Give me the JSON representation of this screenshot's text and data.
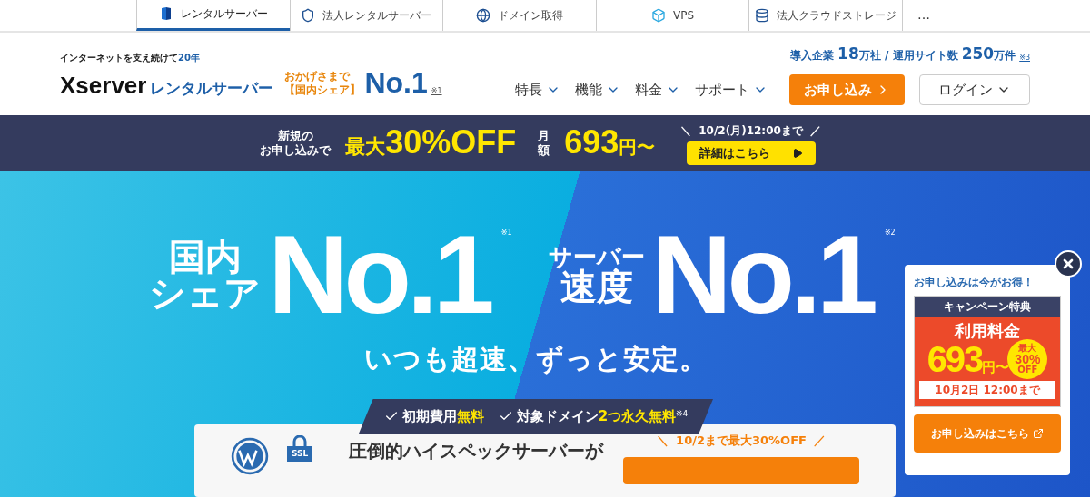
{
  "top_nav": {
    "items": [
      {
        "label": "レンタルサーバー",
        "selected": true,
        "kind": "server"
      },
      {
        "label": "法人レンタルサーバー",
        "selected": false,
        "kind": "shield"
      },
      {
        "label": "ドメイン取得",
        "selected": false,
        "kind": "globe"
      },
      {
        "label": "VPS",
        "selected": false,
        "kind": "cube"
      },
      {
        "label": "法人クラウドストレージ",
        "selected": false,
        "kind": "database"
      }
    ],
    "more": "…"
  },
  "header": {
    "tagline": "インターネットを支え続けて**20年**",
    "logo_word": "Xserver",
    "logo_sub": "レンタルサーバー",
    "award_lines": [
      "おかげさまで",
      "【国内シェア】"
    ],
    "award_big": "No.1",
    "award_note": "※1",
    "stats": "導入企業 **18**万社 / 運用サイト数 **250**万件",
    "stats_note": "※3",
    "menu": [
      "特長",
      "機能",
      "料金",
      "サポート"
    ],
    "cta": "お申し込み",
    "login": "ログイン"
  },
  "banner": {
    "lead": [
      "新規の",
      "お申し込みで"
    ],
    "max": "最大",
    "discount": "30%OFF",
    "monthly": [
      "月",
      "額"
    ],
    "price": "693",
    "unit": "円〜",
    "deadline": "10/2(月)12:00まで",
    "slashes": [
      "＼",
      "／"
    ],
    "button": "詳細はこちら"
  },
  "hero": {
    "claims": [
      {
        "label": [
          "国内",
          "シェア"
        ],
        "big": "No.1",
        "note": "※1"
      },
      {
        "label": [
          "サーバー",
          "速度"
        ],
        "big": "No.1",
        "note": "※2"
      }
    ],
    "slogan": "いつも超速、ずっと安定。",
    "ribbon": [
      "初期費用**無料**",
      "対象ドメイン**2つ永久無料**$^{※4}$"
    ],
    "card": {
      "ssl": "SSL",
      "title": "圧倒的ハイスペックサーバーが",
      "offer": "10/2まで最大30%OFF",
      "slashes": [
        "＼",
        "／"
      ]
    }
  },
  "popup": {
    "heading": "お申し込みは今がお得！",
    "campaign": "キャンペーン特典",
    "label": "利用料金",
    "price": "693",
    "unit": "円〜",
    "badge": [
      "最大",
      "30%",
      "OFF"
    ],
    "deadline": "10月2日 12:00まで",
    "button": "お申し込みはこちら"
  }
}
